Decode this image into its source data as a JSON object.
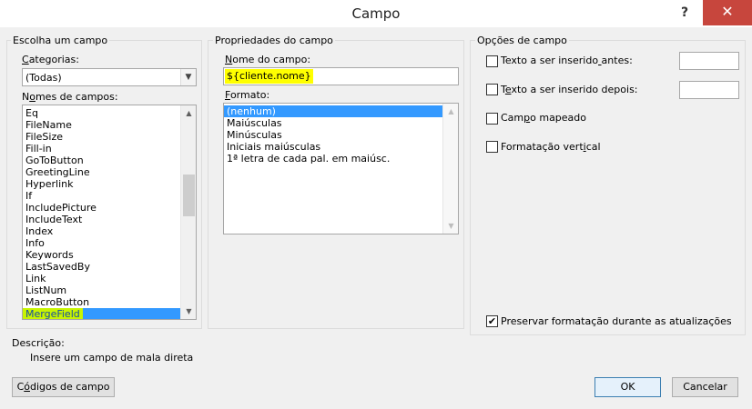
{
  "window": {
    "title": "Campo",
    "help_glyph": "?",
    "close_glyph": "✕"
  },
  "left_panel": {
    "group_title": "Escolha um campo",
    "categories_label": "Categorias:",
    "categories_value": "(Todas)",
    "field_names_label": "Nomes de campos:",
    "field_names": [
      "Eq",
      "FileName",
      "FileSize",
      "Fill-in",
      "GoToButton",
      "GreetingLine",
      "Hyperlink",
      "If",
      "IncludePicture",
      "IncludeText",
      "Index",
      "Info",
      "Keywords",
      "LastSavedBy",
      "Link",
      "ListNum",
      "MacroButton",
      "MergeField"
    ],
    "selected_field": "MergeField"
  },
  "middle_panel": {
    "group_title": "Propriedades do campo",
    "field_name_label": "Nome do campo:",
    "field_name_value": "${cliente.nome}",
    "format_label": "Formato:",
    "formats": [
      "(nenhum)",
      "Maiúsculas",
      "Minúsculas",
      "Iniciais maiúsculas",
      "1ª letra de cada pal. em maiúsc."
    ],
    "selected_format": "(nenhum)"
  },
  "right_panel": {
    "group_title": "Opções de campo",
    "options": [
      {
        "label": "Texto a ser inserido antes:",
        "checked": false
      },
      {
        "label": "Texto a ser inserido depois:",
        "checked": false
      },
      {
        "label": "Campo mapeado",
        "checked": false
      },
      {
        "label": "Formatação vertical",
        "checked": false
      }
    ],
    "preserve_label": "Preservar formatação durante as atualizações",
    "preserve_checked": true,
    "check_glyph": "✔"
  },
  "description": {
    "label": "Descrição:",
    "text": "Insere um campo de mala direta"
  },
  "buttons": {
    "field_codes": "Códigos de campo",
    "ok": "OK",
    "cancel": "Cancelar"
  }
}
